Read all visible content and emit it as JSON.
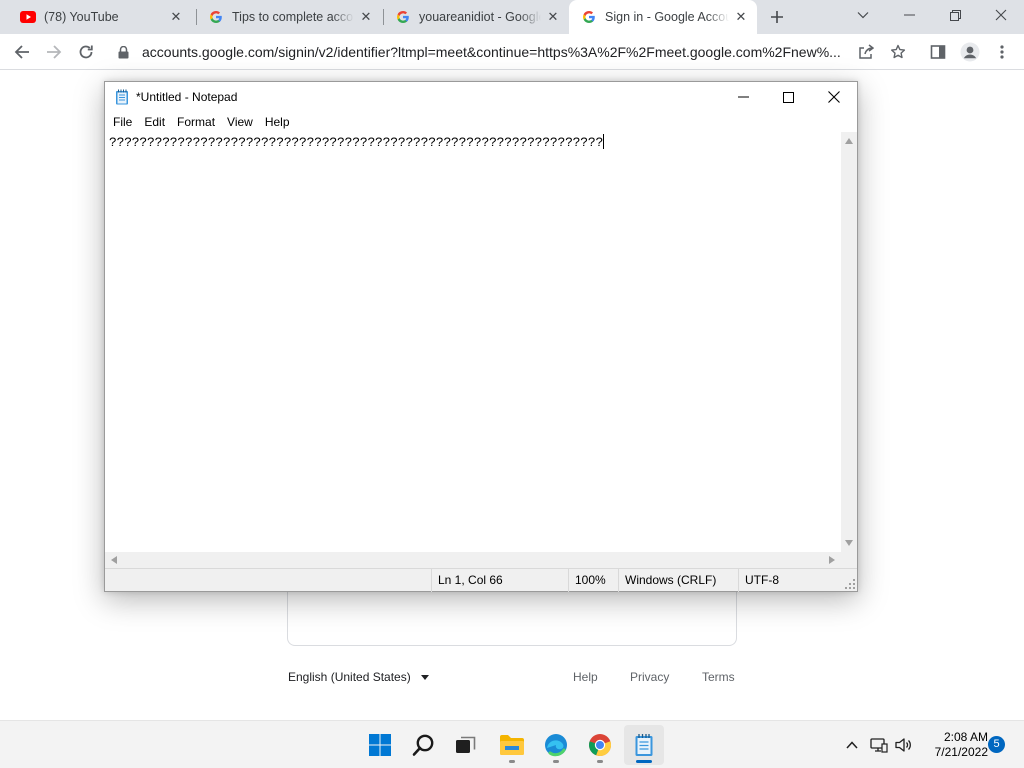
{
  "browser": {
    "tabs": [
      {
        "title": "(78) YouTube",
        "favicon": "youtube-icon",
        "active": false
      },
      {
        "title": "Tips to complete account recovery",
        "favicon": "google-icon",
        "active": false
      },
      {
        "title": "youareanidiot - Google Search",
        "favicon": "google-icon",
        "active": false
      },
      {
        "title": "Sign in - Google Accounts",
        "favicon": "google-icon",
        "active": true
      }
    ],
    "url": "accounts.google.com/signin/v2/identifier?ltmpl=meet&continue=https%3A%2F%2Fmeet.google.com%2Fnew%..."
  },
  "page": {
    "language": "English (United States)",
    "footer_links": [
      "Help",
      "Privacy",
      "Terms"
    ]
  },
  "notepad": {
    "title": "*Untitled - Notepad",
    "menu": [
      "File",
      "Edit",
      "Format",
      "View",
      "Help"
    ],
    "content": "?????????????????????????????????????????????????????????????????",
    "status": {
      "position": "Ln 1, Col 66",
      "zoom": "100%",
      "line_ending": "Windows (CRLF)",
      "encoding": "UTF-8"
    }
  },
  "taskbar": {
    "time": "2:08 AM",
    "date": "7/21/2022",
    "notification_count": "5",
    "apps": [
      "start-icon",
      "search-icon",
      "task-view-icon",
      "file-explorer-icon",
      "edge-icon",
      "chrome-icon",
      "notepad-icon"
    ]
  },
  "colors": {
    "accent": "#0067c0",
    "tabstrip": "#dee1e6",
    "youtube_red": "#ff0000"
  }
}
